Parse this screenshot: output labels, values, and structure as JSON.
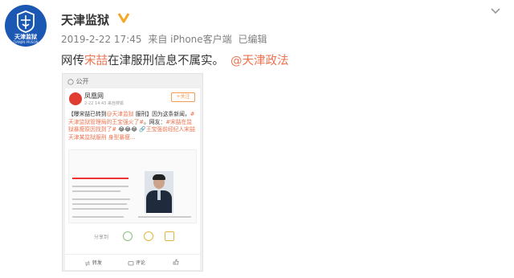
{
  "account": {
    "name": "天津监狱",
    "logo_text": "天津监狱",
    "logo_sub": "TIANJIN PRISON"
  },
  "post": {
    "meta": {
      "datetime": "2019-2-22 17:45",
      "source": "来自 iPhone客户端",
      "edited": "已编辑"
    },
    "text_prefix": "网传",
    "text_highlight": "宋喆",
    "text_rest": "在津服刑信息不属实。",
    "mention": "@天津政法"
  },
  "screenshot": {
    "visibility": "公开",
    "author": "凤凰网",
    "time": "2-22 14:43   来自搜狐    ",
    "follow_label": "+关注",
    "text_1": "【曝宋喆已转到",
    "tag_1": "@天津监狱",
    "text_2": " 服刑】因为这条新闻，",
    "tag_2": "#天津监狱管理局的王宝强火了#",
    "text_3": "。网友：",
    "tag_3": "#宋喆在监狱暴瘦原因找到了#",
    "text_4": " 😂😂😂 ",
    "tag_4": "🔗王宝强前经纪人宋喆天津某监狱服刑 身型暴瘦...",
    "share_label": "分享到",
    "repost_label": "转发",
    "comment_label": "评论"
  },
  "colors": {
    "accent": "#eb7350",
    "verified": "#f5a623",
    "brand_blue": "#1b58b3"
  }
}
